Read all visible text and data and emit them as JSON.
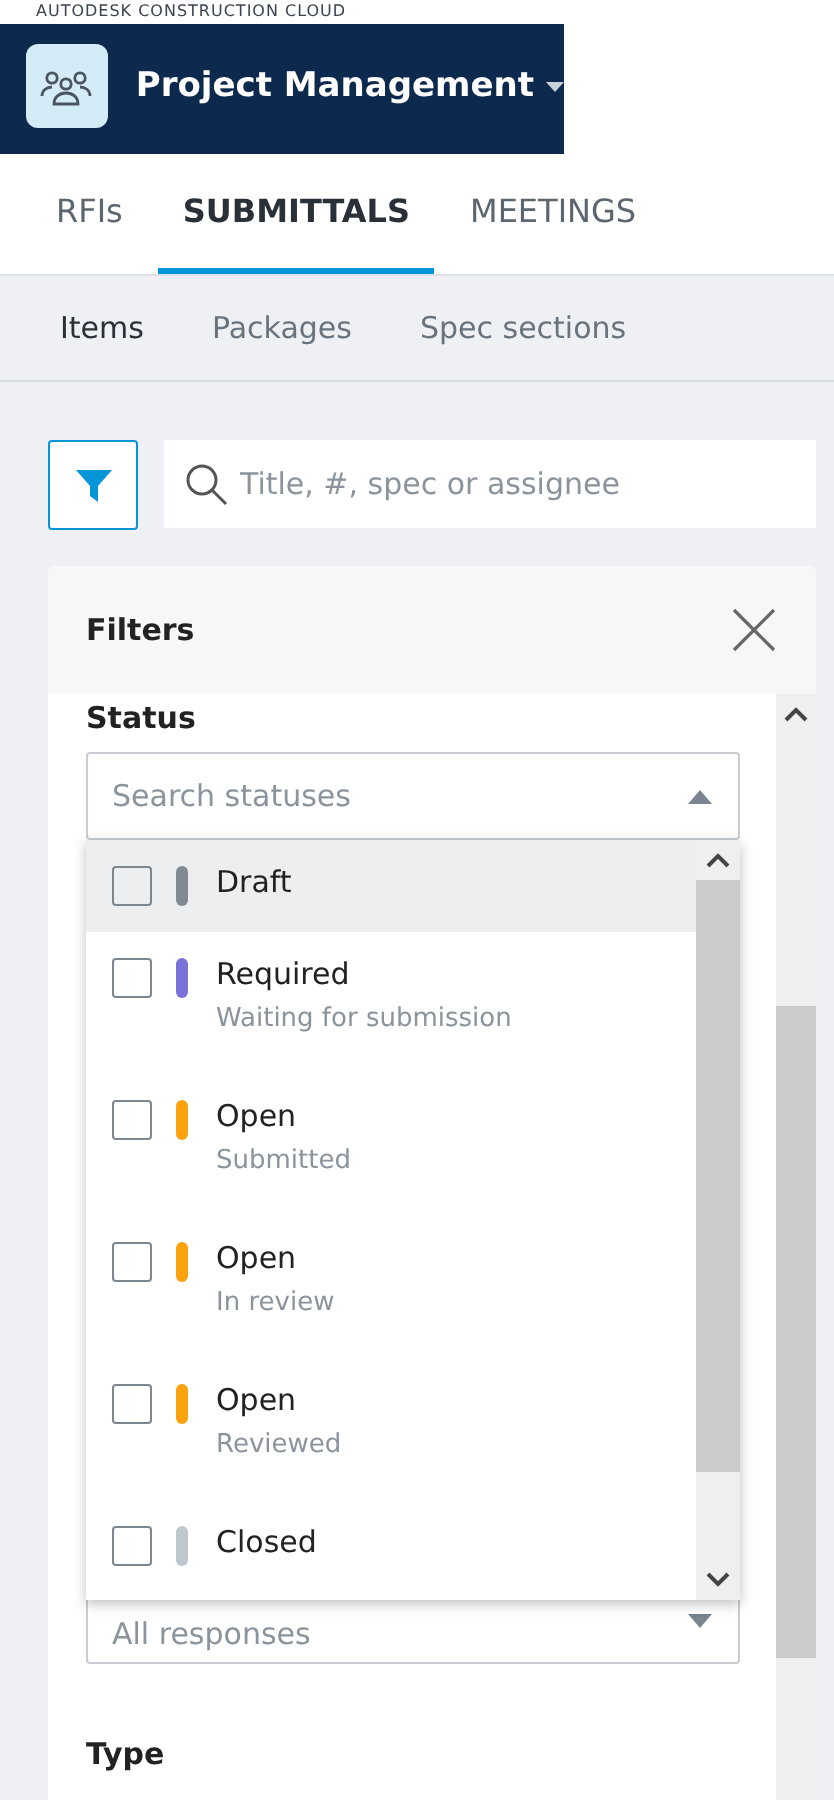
{
  "header": {
    "brand": "AUTODESK CONSTRUCTION CLOUD",
    "project": "Project Management"
  },
  "tabs": [
    {
      "label": "RFIs",
      "selected": false
    },
    {
      "label": "SUBMITTALS",
      "selected": true
    },
    {
      "label": "MEETINGS",
      "selected": false
    }
  ],
  "subtabs": [
    {
      "label": "Items",
      "selected": true
    },
    {
      "label": "Packages",
      "selected": false
    },
    {
      "label": "Spec sections",
      "selected": false
    }
  ],
  "search": {
    "placeholder": "Title, #, spec or assignee"
  },
  "filters": {
    "title": "Filters",
    "status_label": "Status",
    "status_search": {
      "placeholder": "Search statuses"
    },
    "status_options": [
      {
        "label": "Draft",
        "color": "#7f8a93",
        "checked": false,
        "highlighted": true
      },
      {
        "label": "Required",
        "sublabel": "Waiting for submission",
        "color": "#7b72d9",
        "checked": false,
        "highlighted": false
      },
      {
        "label": "Open",
        "sublabel": "Submitted",
        "color": "#f9a20e",
        "checked": false,
        "highlighted": false
      },
      {
        "label": "Open",
        "sublabel": "In review",
        "color": "#f9a20e",
        "checked": false,
        "highlighted": false
      },
      {
        "label": "Open",
        "sublabel": "Reviewed",
        "color": "#f9a20e",
        "checked": false,
        "highlighted": false
      },
      {
        "label": "Closed",
        "color": "#bcc7ce",
        "checked": false,
        "highlighted": false
      }
    ],
    "response_field": {
      "placeholder": "All responses"
    },
    "type_label": "Type"
  }
}
